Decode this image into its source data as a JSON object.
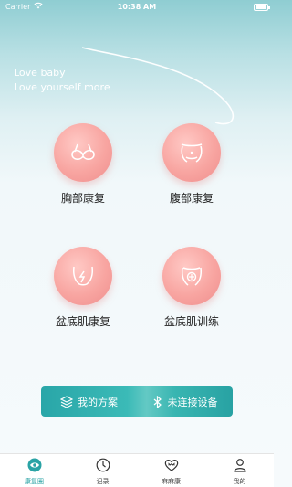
{
  "status_bar": {
    "carrier": "Carrier",
    "time": "10:38 AM"
  },
  "header": {
    "slogan_line1": "Love baby",
    "slogan_line2": "Love yourself more"
  },
  "modules": [
    {
      "label": "胸部康复",
      "icon": "bra-icon"
    },
    {
      "label": "腹部康复",
      "icon": "belly-icon"
    },
    {
      "label": "盆底肌康复",
      "icon": "pelvic-floor-icon"
    },
    {
      "label": "盆底肌训练",
      "icon": "pelvic-training-icon"
    }
  ],
  "action_bar": {
    "plan_label": "我的方案",
    "device_label": "未连接设备"
  },
  "tab_bar": {
    "items": [
      {
        "label": "康复圈",
        "active": true
      },
      {
        "label": "记录",
        "active": false
      },
      {
        "label": "麻麻康",
        "active": false
      },
      {
        "label": "我的",
        "active": false
      }
    ]
  },
  "colors": {
    "accent": "#2aa3a5",
    "module_circle": "#f8a5a1"
  }
}
